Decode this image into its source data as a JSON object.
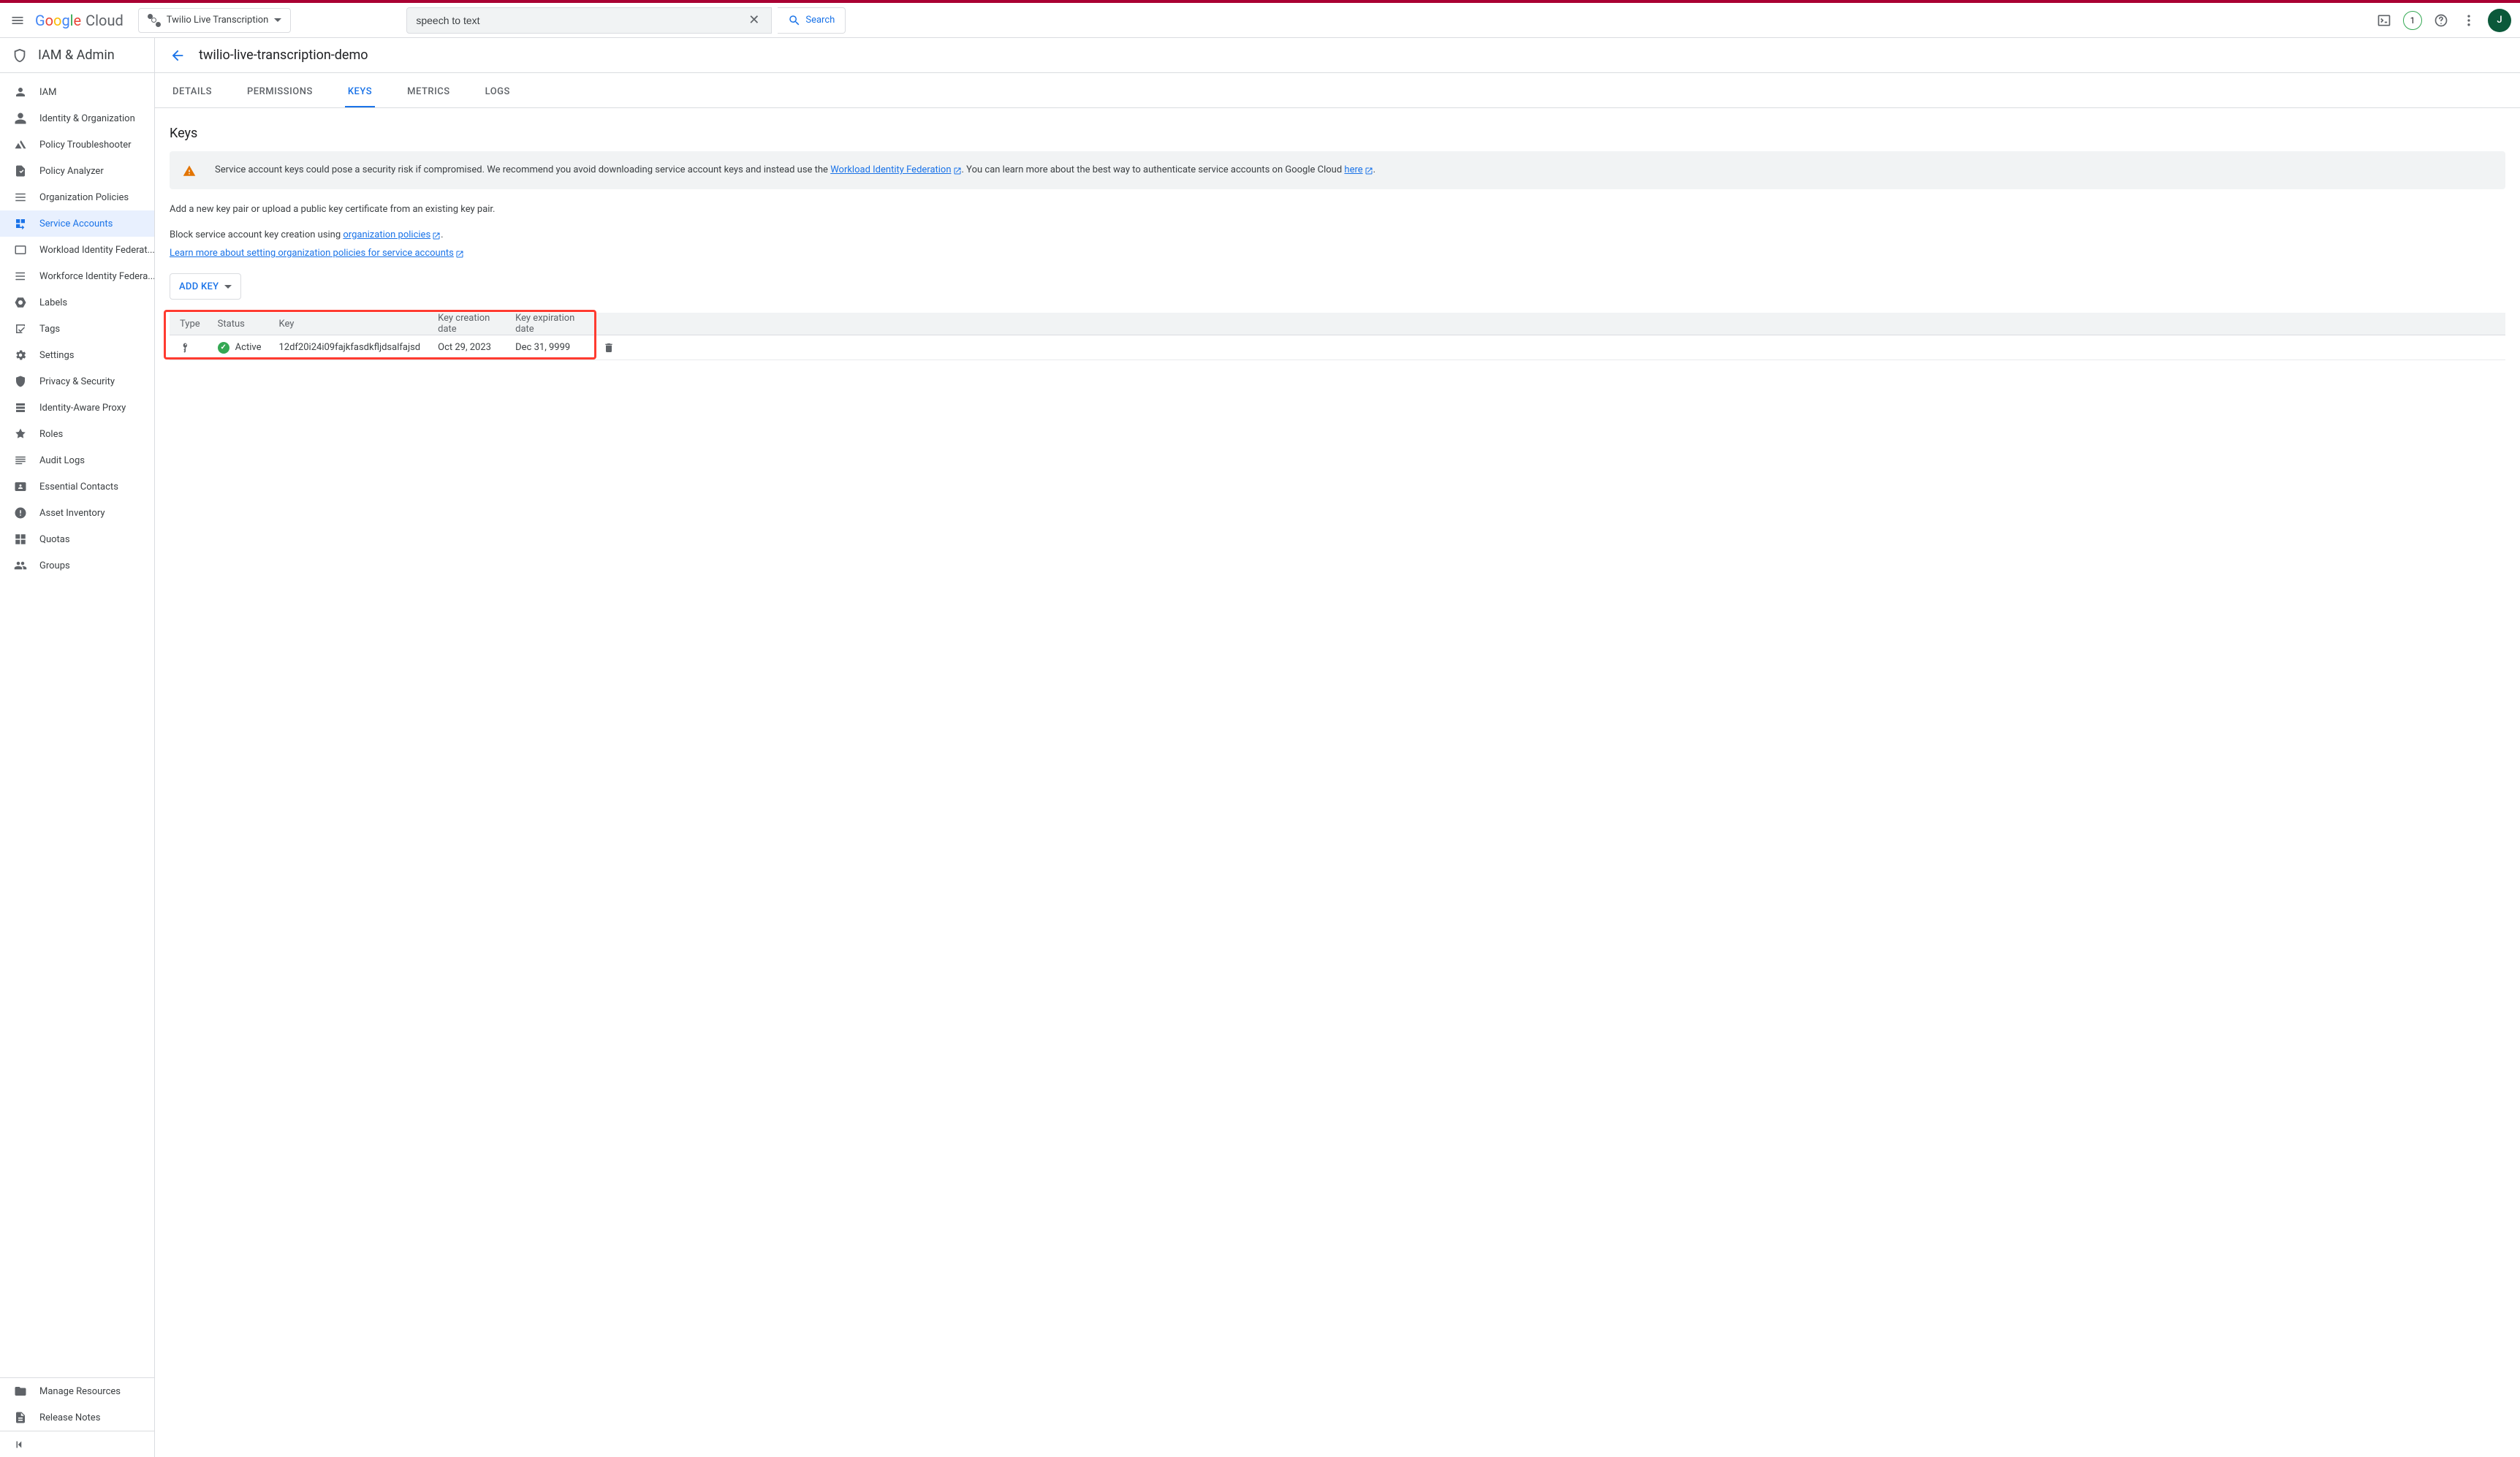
{
  "header": {
    "logo_text": "Google",
    "logo_suffix": "Cloud",
    "project_name": "Twilio Live Transcription",
    "search_value": "speech to text",
    "search_button": "Search",
    "trial_count": "1",
    "avatar_initial": "J"
  },
  "sidebar": {
    "section_title": "IAM & Admin",
    "items": [
      {
        "label": "IAM"
      },
      {
        "label": "Identity & Organization"
      },
      {
        "label": "Policy Troubleshooter"
      },
      {
        "label": "Policy Analyzer"
      },
      {
        "label": "Organization Policies"
      },
      {
        "label": "Service Accounts",
        "active": true
      },
      {
        "label": "Workload Identity Federat..."
      },
      {
        "label": "Workforce Identity Federa..."
      },
      {
        "label": "Labels"
      },
      {
        "label": "Tags"
      },
      {
        "label": "Settings"
      },
      {
        "label": "Privacy & Security"
      },
      {
        "label": "Identity-Aware Proxy"
      },
      {
        "label": "Roles"
      },
      {
        "label": "Audit Logs"
      },
      {
        "label": "Essential Contacts"
      },
      {
        "label": "Asset Inventory"
      },
      {
        "label": "Quotas"
      },
      {
        "label": "Groups"
      }
    ],
    "footer_items": [
      {
        "label": "Manage Resources"
      },
      {
        "label": "Release Notes"
      }
    ]
  },
  "page": {
    "title": "twilio-live-transcription-demo",
    "tabs": [
      "DETAILS",
      "PERMISSIONS",
      "KEYS",
      "METRICS",
      "LOGS"
    ],
    "active_tab_index": 2,
    "section_title": "Keys",
    "banner_text_1": "Service account keys could pose a security risk if compromised. We recommend you avoid downloading service account keys and instead use the ",
    "banner_link_1": "Workload Identity Federation",
    "banner_text_2": ". You can learn more about the best way to authenticate service accounts on Google Cloud ",
    "banner_link_2": "here",
    "banner_text_3": ".",
    "add_text": "Add a new key pair or upload a public key certificate from an existing key pair.",
    "block_text_1": "Block service account key creation using ",
    "block_link_1": "organization policies",
    "block_text_2": ".",
    "learn_link": "Learn more about setting organization policies for service accounts",
    "add_key_button": "ADD KEY",
    "table": {
      "headers": [
        "Type",
        "Status",
        "Key",
        "Key creation date",
        "Key expiration date",
        ""
      ],
      "row": {
        "status": "Active",
        "key": "12df20i24i09fajkfasdkfljdsalfajsd",
        "created": "Oct 29, 2023",
        "expires": "Dec 31, 9999"
      }
    }
  }
}
